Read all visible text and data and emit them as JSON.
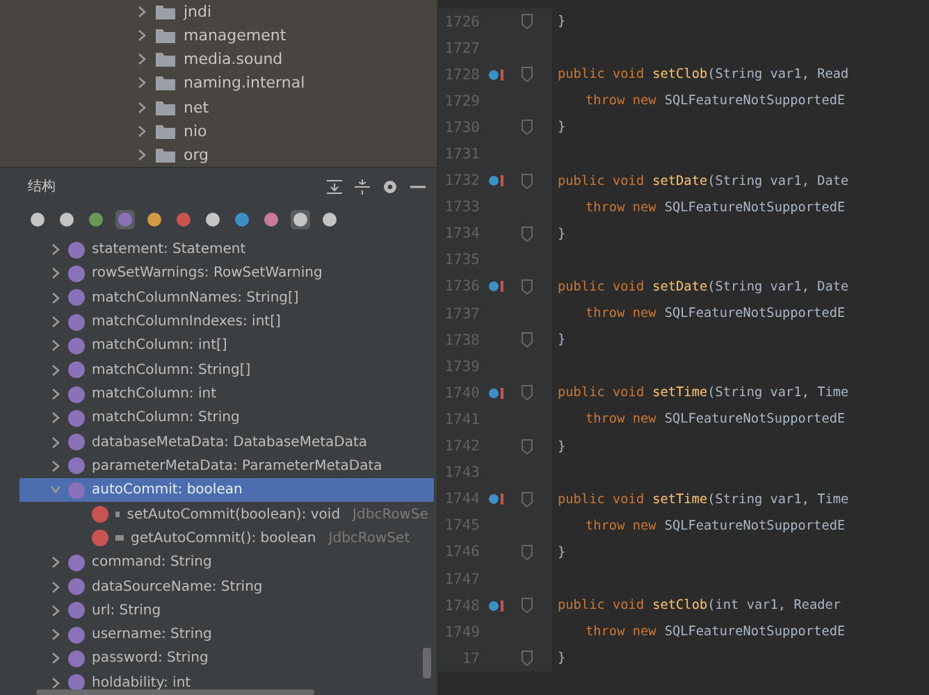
{
  "project_tree": {
    "folders": [
      {
        "name": "jndi"
      },
      {
        "name": "management"
      },
      {
        "name": "media.sound"
      },
      {
        "name": "naming.internal"
      },
      {
        "name": "net"
      },
      {
        "name": "nio"
      },
      {
        "name": "org"
      }
    ]
  },
  "structure": {
    "title": "结构",
    "members": [
      {
        "kind": "property",
        "label": "statement: Statement",
        "selected": false,
        "expanded": false
      },
      {
        "kind": "property",
        "label": "rowSetWarnings: RowSetWarning",
        "selected": false,
        "expanded": false
      },
      {
        "kind": "property",
        "label": "matchColumnNames: String[]",
        "selected": false,
        "expanded": false
      },
      {
        "kind": "property",
        "label": "matchColumnIndexes: int[]",
        "selected": false,
        "expanded": false
      },
      {
        "kind": "property",
        "label": "matchColumn: int[]",
        "selected": false,
        "expanded": false
      },
      {
        "kind": "property",
        "label": "matchColumn: String[]",
        "selected": false,
        "expanded": false
      },
      {
        "kind": "property",
        "label": "matchColumn: int",
        "selected": false,
        "expanded": false
      },
      {
        "kind": "property",
        "label": "matchColumn: String",
        "selected": false,
        "expanded": false
      },
      {
        "kind": "property",
        "label": "databaseMetaData: DatabaseMetaData",
        "selected": false,
        "expanded": false
      },
      {
        "kind": "property",
        "label": "parameterMetaData: ParameterMetaData",
        "selected": false,
        "expanded": false
      },
      {
        "kind": "property",
        "label": "autoCommit: boolean",
        "selected": true,
        "expanded": true,
        "children": [
          {
            "kind": "method",
            "label": "setAutoCommit(boolean): void",
            "origin": "JdbcRowSe",
            "selected": false
          },
          {
            "kind": "method",
            "label": "getAutoCommit(): boolean",
            "origin": "JdbcRowSet",
            "selected": false
          }
        ]
      },
      {
        "kind": "property",
        "label": "command: String",
        "selected": false,
        "expanded": false
      },
      {
        "kind": "property",
        "label": "dataSourceName: String",
        "selected": false,
        "expanded": false
      },
      {
        "kind": "property",
        "label": "url: String",
        "selected": false,
        "expanded": false
      },
      {
        "kind": "property",
        "label": "username: String",
        "selected": false,
        "expanded": false
      },
      {
        "kind": "property",
        "label": "password: String",
        "selected": false,
        "expanded": false
      },
      {
        "kind": "property",
        "label": "holdability: int",
        "selected": false,
        "expanded": false
      }
    ]
  },
  "editor": {
    "lines": [
      {
        "number": "1726",
        "kind": "brace",
        "text": "}"
      },
      {
        "number": "1727",
        "kind": "blank"
      },
      {
        "number": "1728",
        "kind": "signature",
        "override": true,
        "modifiers": "public void",
        "method": "setClob",
        "params": "(String var1, Read"
      },
      {
        "number": "1729",
        "kind": "throw",
        "keyword": "throw new",
        "rest": "SQLFeatureNotSupportedE"
      },
      {
        "number": "1730",
        "kind": "brace",
        "text": "}"
      },
      {
        "number": "1731",
        "kind": "blank"
      },
      {
        "number": "1732",
        "kind": "signature",
        "override": true,
        "modifiers": "public void",
        "method": "setDate",
        "params": "(String var1, Date"
      },
      {
        "number": "1733",
        "kind": "throw",
        "keyword": "throw new",
        "rest": "SQLFeatureNotSupportedE"
      },
      {
        "number": "1734",
        "kind": "brace",
        "text": "}"
      },
      {
        "number": "1735",
        "kind": "blank"
      },
      {
        "number": "1736",
        "kind": "signature",
        "override": true,
        "modifiers": "public void",
        "method": "setDate",
        "params": "(String var1, Date"
      },
      {
        "number": "1737",
        "kind": "throw",
        "keyword": "throw new",
        "rest": "SQLFeatureNotSupportedE"
      },
      {
        "number": "1738",
        "kind": "brace",
        "text": "}"
      },
      {
        "number": "1739",
        "kind": "blank"
      },
      {
        "number": "1740",
        "kind": "signature",
        "override": true,
        "modifiers": "public void",
        "method": "setTime",
        "params": "(String var1, Time"
      },
      {
        "number": "1741",
        "kind": "throw",
        "keyword": "throw new",
        "rest": "SQLFeatureNotSupportedE"
      },
      {
        "number": "1742",
        "kind": "brace",
        "text": "}"
      },
      {
        "number": "1743",
        "kind": "blank"
      },
      {
        "number": "1744",
        "kind": "signature",
        "override": true,
        "modifiers": "public void",
        "method": "setTime",
        "params": "(String var1, Time"
      },
      {
        "number": "1745",
        "kind": "throw",
        "keyword": "throw new",
        "rest": "SQLFeatureNotSupportedE"
      },
      {
        "number": "1746",
        "kind": "brace",
        "text": "}"
      },
      {
        "number": "1747",
        "kind": "blank"
      },
      {
        "number": "1748",
        "kind": "signature",
        "override": true,
        "modifiers": "public void",
        "method": "setClob",
        "params": "(int var1, Reader"
      },
      {
        "number": "1749",
        "kind": "throw",
        "keyword": "throw new",
        "rest": "SQLFeatureNotSupportedE"
      },
      {
        "number": "17",
        "kind": "brace",
        "text": "}"
      }
    ]
  }
}
